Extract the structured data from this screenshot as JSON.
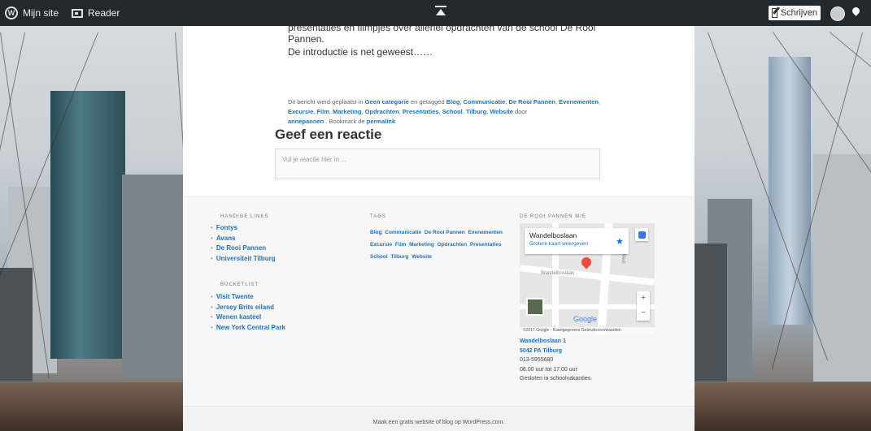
{
  "adminbar": {
    "my_site": "Mijn site",
    "reader": "Reader",
    "write": "Schrijven"
  },
  "post": {
    "line1": "presentaties en filmpjes over allerlei opdrachten van de school De Rooi Pannen.",
    "line2": "De introductie is net geweest……",
    "meta_prefix": "Dit bericht werd geplaatst in",
    "category": "Geen categorie",
    "tagged": "en getagged",
    "tags": [
      "Blog",
      "Communicatie",
      "De Rooi Pannen",
      "Evenementen",
      "Excursie",
      "Film",
      "Marketing",
      "Opdrachten",
      "Presentaties",
      "School",
      "Tilburg",
      "Website"
    ],
    "by": "door",
    "author": "annepannen",
    "bookmark": ". Bookmark de",
    "permalink": "permalink"
  },
  "comment": {
    "title": "Geef een reactie",
    "placeholder": "Vul je reactie hier in ..."
  },
  "footer": {
    "handy_links": {
      "title": "HANDIGE LINKS",
      "items": [
        "Fontys",
        "Avans",
        "De Rooi Pannen",
        "Universiteit Tilburg"
      ]
    },
    "bucketlist": {
      "title": "BUCKETLIST",
      "items": [
        "Visit Twente",
        "Jersey Brits eiland",
        "Wenen kasteel",
        "New York Central Park"
      ]
    },
    "tags": {
      "title": "TAGS",
      "items": [
        "Blog",
        "Communicatie",
        "De Rooi Pannen",
        "Evenementen",
        "Excursie",
        "Film",
        "Marketing",
        "Opdrachten",
        "Presentaties",
        "School",
        "Tilburg",
        "Website"
      ]
    },
    "map_widget": {
      "title": "DE ROOI PANNEN M/E",
      "place": "Wandelboslaan",
      "larger_map": "Grotere kaart weergeven",
      "street_label": "Wandelboslaan",
      "street_label2": "West",
      "google": "Google",
      "copyright": "©2017 Google - Kaartgegevens    Gebruiksvoorwaarden",
      "zoom_in": "+",
      "zoom_out": "−",
      "address_line1": "Wandelboslaan 1",
      "address_line2": "5042 PA Tilburg",
      "phone": "013-5955680",
      "hours": "08.00 uur tot 17.00 uur",
      "closed": "Gesloten in schoolvakanties."
    },
    "credit": "Maak een gratis website of blog op WordPress.com."
  }
}
